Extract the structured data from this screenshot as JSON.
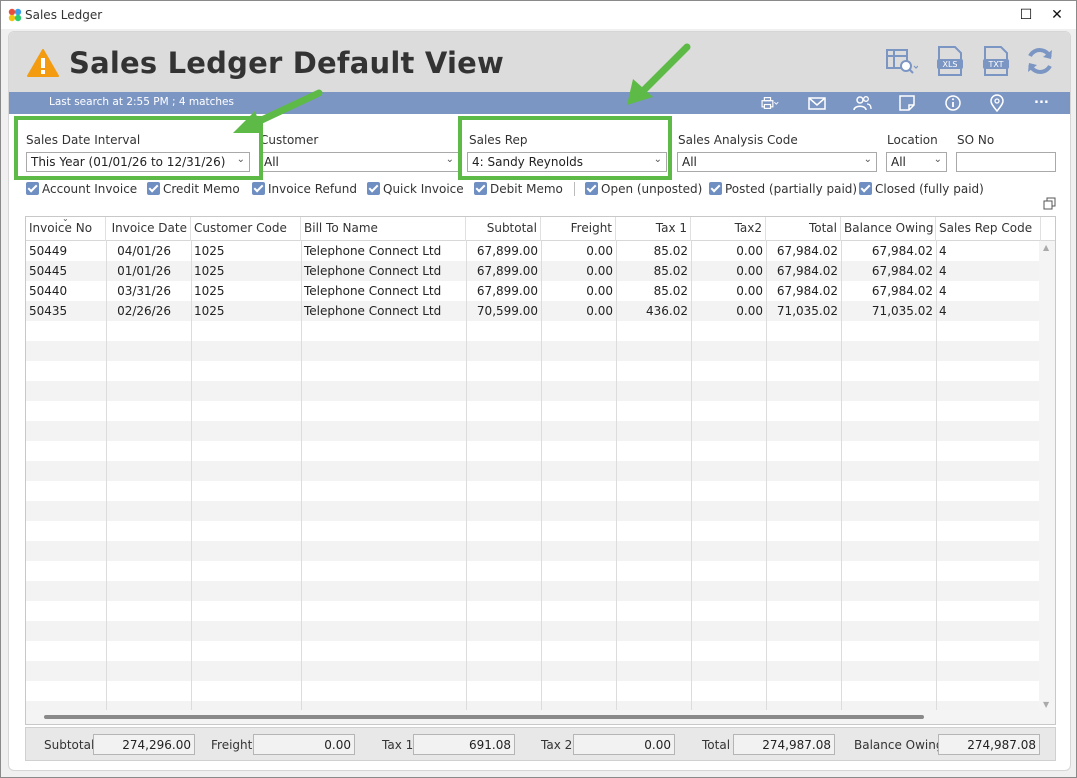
{
  "window": {
    "title": "Sales Ledger",
    "minimize_label": "—",
    "maximize_label": "☐",
    "close_label": "✕"
  },
  "header": {
    "title": "Sales Ledger Default View"
  },
  "toolbar": {
    "last_search": "Last search at 2:55 PM ; 4 matches",
    "more_label": "..."
  },
  "header_icons": [
    "grid-search-icon",
    "xls-export-icon",
    "txt-export-icon",
    "refresh-icon"
  ],
  "bar_icons": [
    "print-icon",
    "email-icon",
    "contacts-icon",
    "note-icon",
    "info-icon",
    "location-icon",
    "more-icon"
  ],
  "filters": {
    "sales_date_interval": {
      "label": "Sales Date Interval",
      "value": "This Year (01/01/26 to 12/31/26)"
    },
    "customer": {
      "label": "Customer",
      "value": "All"
    },
    "sales_rep": {
      "label": "Sales Rep",
      "value": "4: Sandy Reynolds"
    },
    "sales_analysis_code": {
      "label": "Sales Analysis Code",
      "value": "All"
    },
    "location": {
      "label": "Location",
      "value": "All"
    },
    "so_no": {
      "label": "SO No",
      "value": ""
    }
  },
  "checkboxes": [
    {
      "label": "Account Invoice",
      "checked": true
    },
    {
      "label": "Credit Memo",
      "checked": true
    },
    {
      "label": "Invoice Refund",
      "checked": true
    },
    {
      "label": "Quick Invoice",
      "checked": true
    },
    {
      "label": "Debit Memo",
      "checked": true
    },
    {
      "label": "Open (unposted)",
      "checked": true
    },
    {
      "label": "Posted (partially paid)",
      "checked": true
    },
    {
      "label": "Closed (fully paid)",
      "checked": true
    }
  ],
  "table": {
    "columns": [
      "Invoice No",
      "Invoice Date",
      "Customer Code",
      "Bill To Name",
      "Subtotal",
      "Freight",
      "Tax 1",
      "Tax2",
      "Total",
      "Balance Owing",
      "Sales Rep Code"
    ],
    "rows": [
      [
        "50449",
        "04/01/26",
        "1025",
        "Telephone Connect Ltd",
        "67,899.00",
        "0.00",
        "85.02",
        "0.00",
        "67,984.02",
        "67,984.02",
        "4"
      ],
      [
        "50445",
        "01/01/26",
        "1025",
        "Telephone Connect Ltd",
        "67,899.00",
        "0.00",
        "85.02",
        "0.00",
        "67,984.02",
        "67,984.02",
        "4"
      ],
      [
        "50440",
        "03/31/26",
        "1025",
        "Telephone Connect Ltd",
        "67,899.00",
        "0.00",
        "85.02",
        "0.00",
        "67,984.02",
        "67,984.02",
        "4"
      ],
      [
        "50435",
        "02/26/26",
        "1025",
        "Telephone Connect Ltd",
        "70,599.00",
        "0.00",
        "436.02",
        "0.00",
        "71,035.02",
        "71,035.02",
        "4"
      ]
    ]
  },
  "totals": {
    "subtotal": {
      "label": "Subtotal",
      "value": "274,296.00"
    },
    "freight": {
      "label": "Freight",
      "value": "0.00"
    },
    "tax1": {
      "label": "Tax 1",
      "value": "691.08"
    },
    "tax2": {
      "label": "Tax 2",
      "value": "0.00"
    },
    "total": {
      "label": "Total",
      "value": "274,987.08"
    },
    "balance_owing": {
      "label": "Balance Owing",
      "value": "274,987.08"
    }
  },
  "colors": {
    "accent_bar": "#7c96c4",
    "highlight": "#5dba47",
    "warning": "#f39c12",
    "checkbox": "#6f8fc2"
  }
}
